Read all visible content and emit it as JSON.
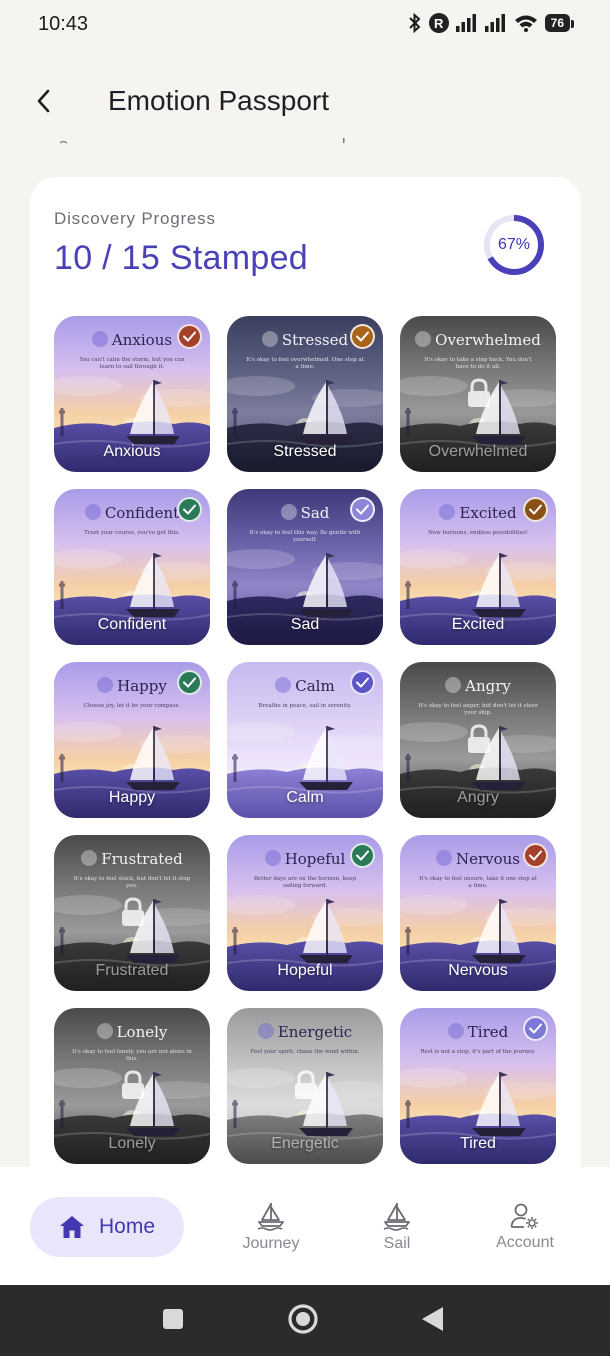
{
  "status_bar": {
    "time": "10:43",
    "battery": "76"
  },
  "header": {
    "title": "Emotion Passport"
  },
  "progress": {
    "label": "Discovery Progress",
    "count": "10 / 15 Stamped",
    "percent_text": "67%",
    "percent_value": 0.67
  },
  "colors": {
    "accent": "#4a40b8",
    "card_bg": "#ffffff",
    "page_bg": "#f5f4f1",
    "nav_active_bg": "#e9e6fb"
  },
  "stamps": [
    {
      "name": "Anxious",
      "heading": "Anxious",
      "sub": "You can't calm the storm, but you can learn to sail through it.",
      "stamped": true,
      "check_color": "#a4412a",
      "theme": "sunset-lavender"
    },
    {
      "name": "Stressed",
      "heading": "Stressed",
      "sub": "It's okay to feel overwhelmed. One step at a time.",
      "stamped": true,
      "check_color": "#a8621a",
      "theme": "storm-navy"
    },
    {
      "name": "Overwhelmed",
      "heading": "Overwhelmed",
      "sub": "It's okay to take a step back. You don't have to do it all.",
      "stamped": false,
      "theme": "storm-gray"
    },
    {
      "name": "Confident",
      "heading": "Confident",
      "sub": "Trust your course, you've got this.",
      "stamped": true,
      "check_color": "#2a7a58",
      "theme": "sunset-lavender"
    },
    {
      "name": "Sad",
      "heading": "Sad",
      "sub": "It's okay to feel this way. Be gentle with yourself.",
      "stamped": true,
      "check_color": "#8b86d8",
      "theme": "dusk-indigo"
    },
    {
      "name": "Excited",
      "heading": "Excited",
      "sub": "New horizons, endless possibilities!",
      "stamped": true,
      "check_color": "#8a5116",
      "theme": "sunset-lavender"
    },
    {
      "name": "Happy",
      "heading": "Happy",
      "sub": "Choose joy, let it be your compass.",
      "stamped": true,
      "check_color": "#2a7a58",
      "theme": "sunset-lavender"
    },
    {
      "name": "Calm",
      "heading": "Calm",
      "sub": "Breathe in peace, sail in serenity.",
      "stamped": true,
      "check_color": "#5c55c8",
      "theme": "pale-lilac"
    },
    {
      "name": "Angry",
      "heading": "Angry",
      "sub": "It's okay to feel anger, but don't let it steer your ship.",
      "stamped": false,
      "theme": "storm-gray"
    },
    {
      "name": "Frustrated",
      "heading": "Frustrated",
      "sub": "It's okay to feel stuck, but don't let it stop you.",
      "stamped": false,
      "theme": "storm-gray"
    },
    {
      "name": "Hopeful",
      "heading": "Hopeful",
      "sub": "Better days are on the horizon, keep sailing forward.",
      "stamped": true,
      "check_color": "#2a7a58",
      "theme": "sunset-lavender"
    },
    {
      "name": "Nervous",
      "heading": "Nervous",
      "sub": "It's okay to feel unsure, take it one step at a time.",
      "stamped": true,
      "check_color": "#a4412a",
      "theme": "sunset-lavender"
    },
    {
      "name": "Lonely",
      "heading": "Lonely",
      "sub": "It's okay to feel lonely, you are not alone in this.",
      "stamped": false,
      "theme": "storm-gray"
    },
    {
      "name": "Energetic",
      "heading": "Energetic",
      "sub": "Feel your spirit, chase the wind within.",
      "stamped": false,
      "theme": "fog-gray"
    },
    {
      "name": "Tired",
      "heading": "Tired",
      "sub": "Rest is not a stop, it's part of the journey.",
      "stamped": true,
      "check_color": "#7d77d6",
      "theme": "sunset-lavender"
    }
  ],
  "nav": {
    "home": "Home",
    "journey": "Journey",
    "sail": "Sail",
    "account": "Account"
  }
}
